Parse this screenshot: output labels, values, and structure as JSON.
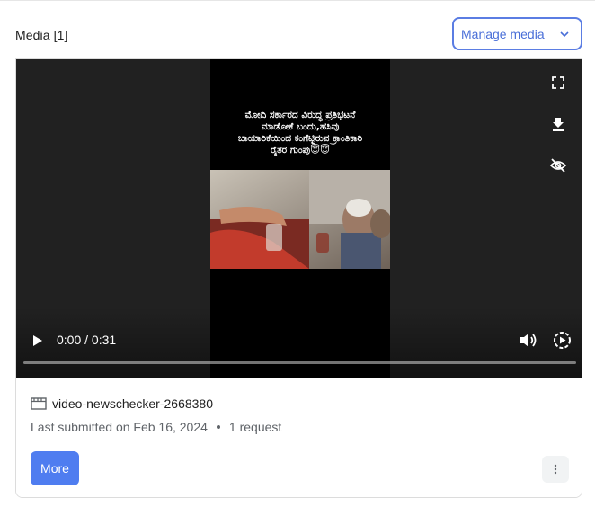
{
  "header": {
    "title": "Media [1]",
    "manage_label": "Manage media"
  },
  "player": {
    "caption_lines": [
      "ಮೋದಿ ಸರ್ಕಾರದ ವಿರುದ್ಧ ಪ್ರತಿಭಟನೆ",
      "ಮಾಡೋಕೆ ಬಂದು,ಹಸಿವು",
      "ಬಾಯಾರಿಕೆಯಿಂದ ಕಂಗೆಟ್ಟಿರುವ ಕ್ರಾಂತಿಕಾರಿ",
      "ರೈತರ ಗುಂಪು😇😇"
    ],
    "time": "0:00 / 0:31",
    "icons": [
      "fullscreen-icon",
      "download-icon",
      "visibility-off-icon",
      "play-icon",
      "volume-icon",
      "playback-speed-icon"
    ]
  },
  "media": {
    "file_name": "video-newschecker-2668380",
    "submitted": "Last submitted on Feb 16, 2024",
    "requests": "1 request",
    "more_label": "More",
    "file_icon": "movie-icon",
    "menu_icon": "more-vert-icon"
  },
  "colors": {
    "accent": "#4f7df0",
    "outline": "#5b7de3",
    "player_bg": "#212121"
  }
}
